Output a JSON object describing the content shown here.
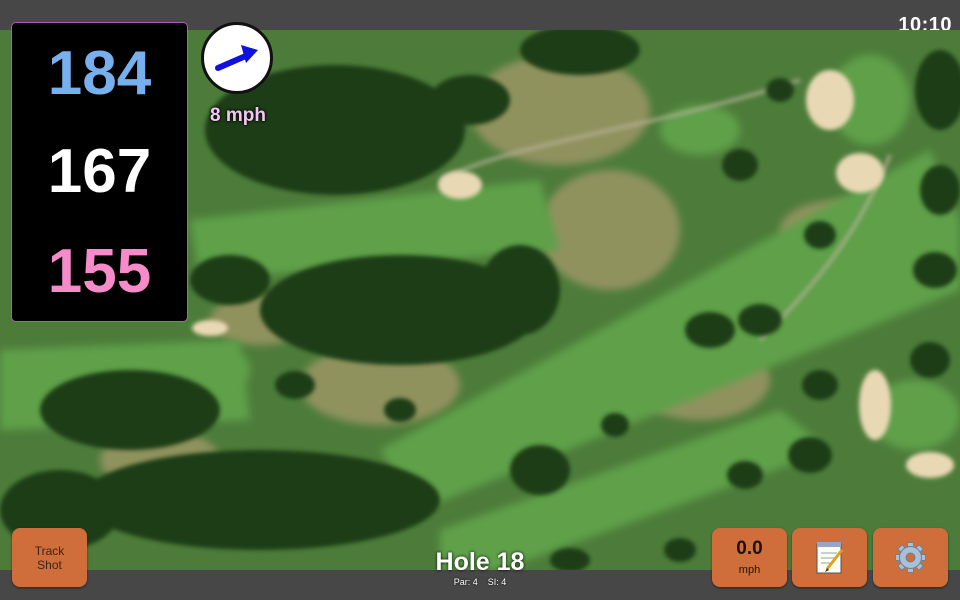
{
  "status_bar": {
    "time": "10:10"
  },
  "distances": {
    "back": "184",
    "middle": "167",
    "front": "155"
  },
  "wind": {
    "speed_text": "8 mph",
    "direction_icon": "arrow-icon"
  },
  "hole": {
    "title": "Hole 18",
    "par_label": "Par: 4",
    "si_label": "SI: 4"
  },
  "buttons": {
    "track_shot_line1": "Track",
    "track_shot_line2": "Shot",
    "speed_value": "0.0",
    "speed_unit": "mph",
    "notes_icon": "notepad-icon",
    "settings_icon": "gear-icon"
  },
  "colors": {
    "back_distance": "#78b0ee",
    "middle_distance": "#ffffff",
    "front_distance": "#f68bca",
    "button": "#cf6e3a",
    "wind_arrow": "#1010e0"
  }
}
